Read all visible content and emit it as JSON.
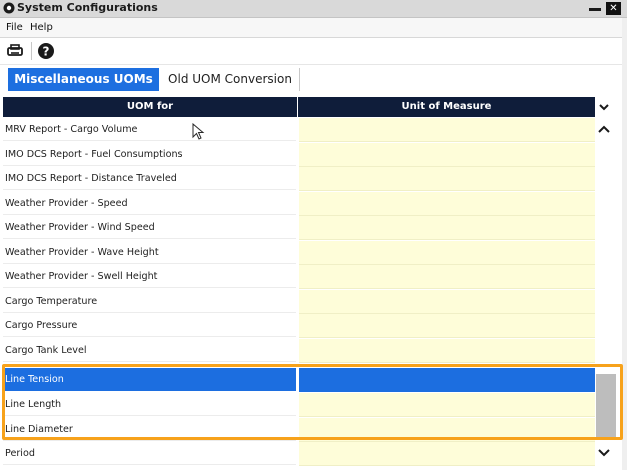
{
  "window": {
    "title": "System Configurations",
    "close_glyph": "✕"
  },
  "menu": {
    "file": "File",
    "help": "Help"
  },
  "toolbar": {
    "icons": [
      "printer-icon",
      "help-circle-icon"
    ]
  },
  "tabs": [
    {
      "label": "Miscellaneous UOMs",
      "active": true
    },
    {
      "label": "Old UOM Conversion",
      "active": false
    }
  ],
  "grid": {
    "columns": [
      "UOM for",
      "Unit of Measure"
    ],
    "rows": [
      {
        "label": "MRV Report - Cargo Volume",
        "value": ""
      },
      {
        "label": "IMO DCS Report - Fuel Consumptions",
        "value": ""
      },
      {
        "label": "IMO DCS Report - Distance Traveled",
        "value": ""
      },
      {
        "label": "Weather Provider - Speed",
        "value": ""
      },
      {
        "label": "Weather Provider - Wind Speed",
        "value": ""
      },
      {
        "label": "Weather Provider - Wave Height",
        "value": ""
      },
      {
        "label": "Weather Provider - Swell Height",
        "value": ""
      },
      {
        "label": "Cargo Temperature",
        "value": ""
      },
      {
        "label": "Cargo Pressure",
        "value": ""
      },
      {
        "label": "Cargo Tank Level",
        "value": ""
      },
      {
        "label": "Line Tension",
        "value": "",
        "selected": true
      },
      {
        "label": "Line Length",
        "value": ""
      },
      {
        "label": "Line Diameter",
        "value": ""
      },
      {
        "label": "Period",
        "value": ""
      }
    ]
  },
  "colors": {
    "accent": "#1d6fe0",
    "header_bg": "#0f1d3a",
    "value_cell": "#fefdd9",
    "highlight": "#f7a21b"
  }
}
